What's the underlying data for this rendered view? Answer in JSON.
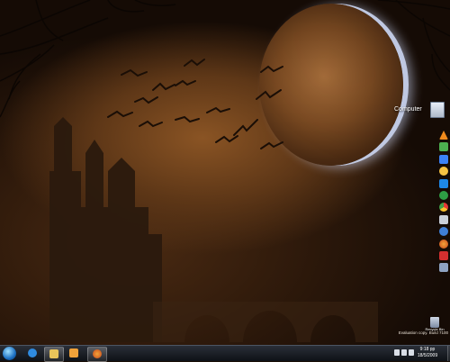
{
  "desktop": {
    "icons": {
      "computer": {
        "label": "Computer",
        "icon": "computer-icon"
      },
      "recycle_bin": {
        "label": "Recycle Bin",
        "icon": "recycle-bin-icon"
      }
    },
    "side_icons": [
      {
        "name": "vlc-icon",
        "color": "#f08a1c"
      },
      {
        "name": "utorrent-icon",
        "color": "#4caf50"
      },
      {
        "name": "notepad-icon",
        "color": "#3b82f6"
      },
      {
        "name": "sticky-icon",
        "color": "#f6c343"
      },
      {
        "name": "media-icon",
        "color": "#1e88e5"
      },
      {
        "name": "green-app-icon",
        "color": "#2e9e44"
      },
      {
        "name": "chrome-icon",
        "color": "#e8b31a"
      },
      {
        "name": "printer-icon",
        "color": "#c9cfd8"
      },
      {
        "name": "ie-icon",
        "color": "#3f7fd6"
      },
      {
        "name": "firefox-icon",
        "color": "#e46b1b"
      },
      {
        "name": "avira-icon",
        "color": "#d32f2f"
      },
      {
        "name": "computer-small-icon",
        "color": "#8fa3c2"
      }
    ]
  },
  "watermark": {
    "line1": "Evaluation copy. Build 7100"
  },
  "taskbar": {
    "start_icon": "windows-start-icon",
    "pinned": [
      {
        "name": "internet-explorer-icon",
        "color": "#2f8be0"
      },
      {
        "name": "explorer-icon",
        "color": "#e8c35a"
      },
      {
        "name": "media-player-icon",
        "color": "#f0a23a"
      },
      {
        "name": "firefox-icon",
        "color": "#e46b1b"
      }
    ],
    "clock": {
      "time": "9:18 pp",
      "date": "18/5/2009"
    }
  }
}
